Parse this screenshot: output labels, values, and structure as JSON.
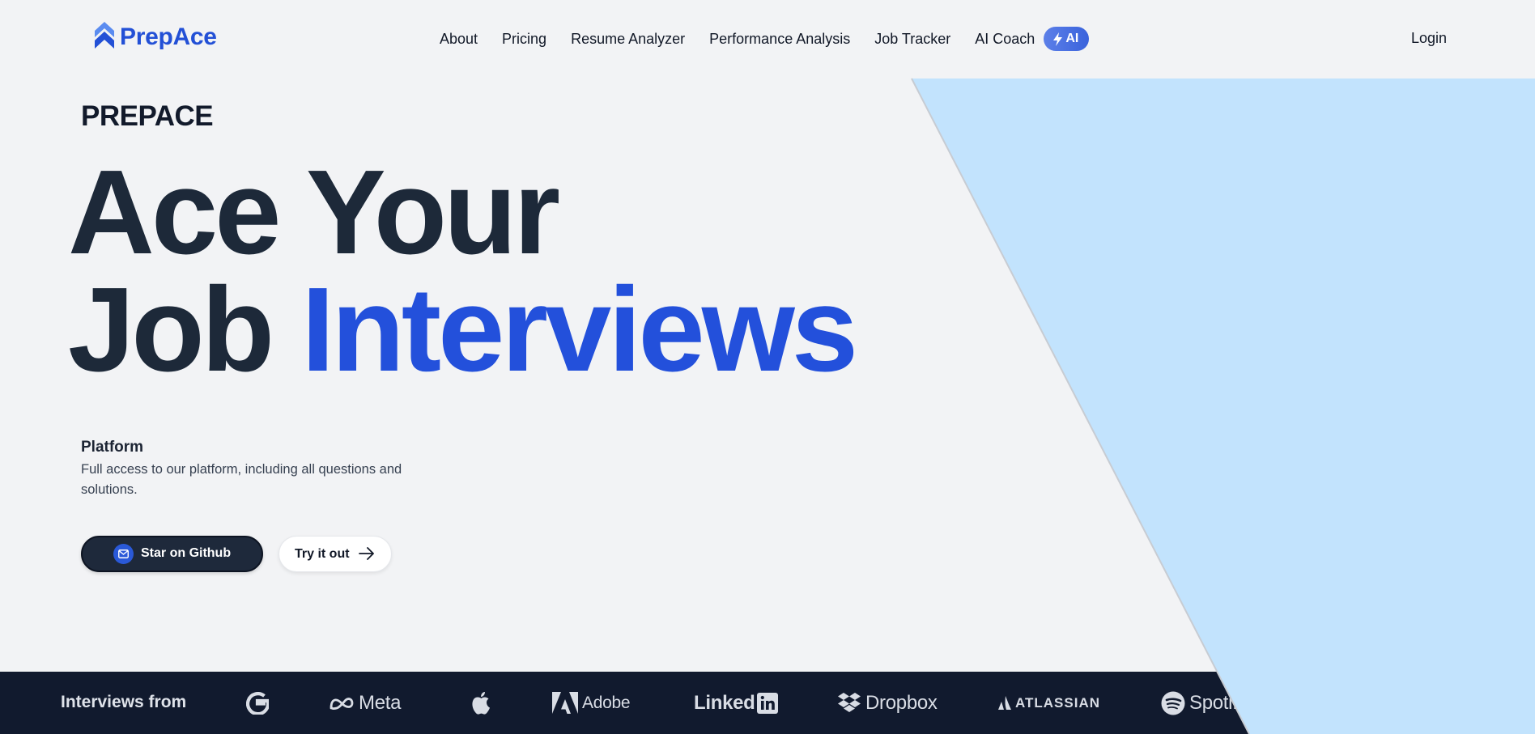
{
  "nav": {
    "brand": "PrepAce",
    "links": [
      "About",
      "Pricing",
      "Resume Analyzer",
      "Performance Analysis",
      "Job Tracker",
      "AI Coach"
    ],
    "ai_badge": "AI",
    "login": "Login"
  },
  "hero": {
    "eyebrow": "PREPACE",
    "headline_line1": "Ace Your",
    "headline_line2_plain": "Job ",
    "headline_line2_accent": "Interviews",
    "feature_title": "Platform",
    "feature_desc": "Full access to our platform, including all questions and solutions.",
    "primary_button": "Star on Github",
    "secondary_button": "Try it out"
  },
  "strip": {
    "label": "Interviews from",
    "brands": [
      "Meta",
      "Adobe",
      "Linked",
      "Dropbox",
      "ATLASSIAN",
      "Spotify"
    ],
    "brand_icons": [
      "google-icon",
      "meta-icon",
      "apple-icon",
      "adobe-icon",
      "linkedin-icon",
      "dropbox-icon",
      "atlassian-icon",
      "spotify-icon"
    ]
  },
  "colors": {
    "background": "#f2f3f5",
    "brand_blue": "#2350db",
    "headline_dark": "#1d2939",
    "hero_shape": "#c2e3fd",
    "strip_bg": "#111a2e",
    "button_dark": "#1e293b"
  }
}
